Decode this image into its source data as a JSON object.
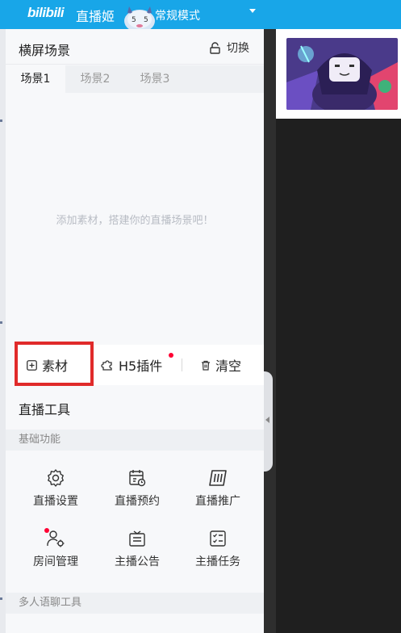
{
  "titlebar": {
    "logo": "bilibili",
    "app_name": "直播姬",
    "mode": "常规模式"
  },
  "scene_panel": {
    "title": "横屏场景",
    "switch_label": "切换",
    "tabs": [
      {
        "label": "场景1",
        "active": true
      },
      {
        "label": "场景2",
        "active": false
      },
      {
        "label": "场景3",
        "active": false
      }
    ],
    "empty_hint": "添加素材，搭建你的直播场景吧！",
    "actions": {
      "material": "素材",
      "h5_plugin": "H5插件",
      "clear": "清空"
    }
  },
  "live_tools": {
    "title": "直播工具",
    "sections": [
      {
        "label": "基础功能",
        "tools": [
          {
            "label": "直播设置",
            "icon": "gear-icon"
          },
          {
            "label": "直播预约",
            "icon": "calendar-clock-icon"
          },
          {
            "label": "直播推广",
            "icon": "ticket-icon"
          },
          {
            "label": "房间管理",
            "icon": "user-settings-icon",
            "badge": true
          },
          {
            "label": "主播公告",
            "icon": "announcement-icon"
          },
          {
            "label": "主播任务",
            "icon": "task-list-icon"
          }
        ]
      },
      {
        "label": "多人语聊工具",
        "tools": []
      }
    ]
  },
  "colors": {
    "titlebar_bg": "#18a6e8",
    "highlight_border": "#e02a2a",
    "badge": "#ff0033"
  }
}
